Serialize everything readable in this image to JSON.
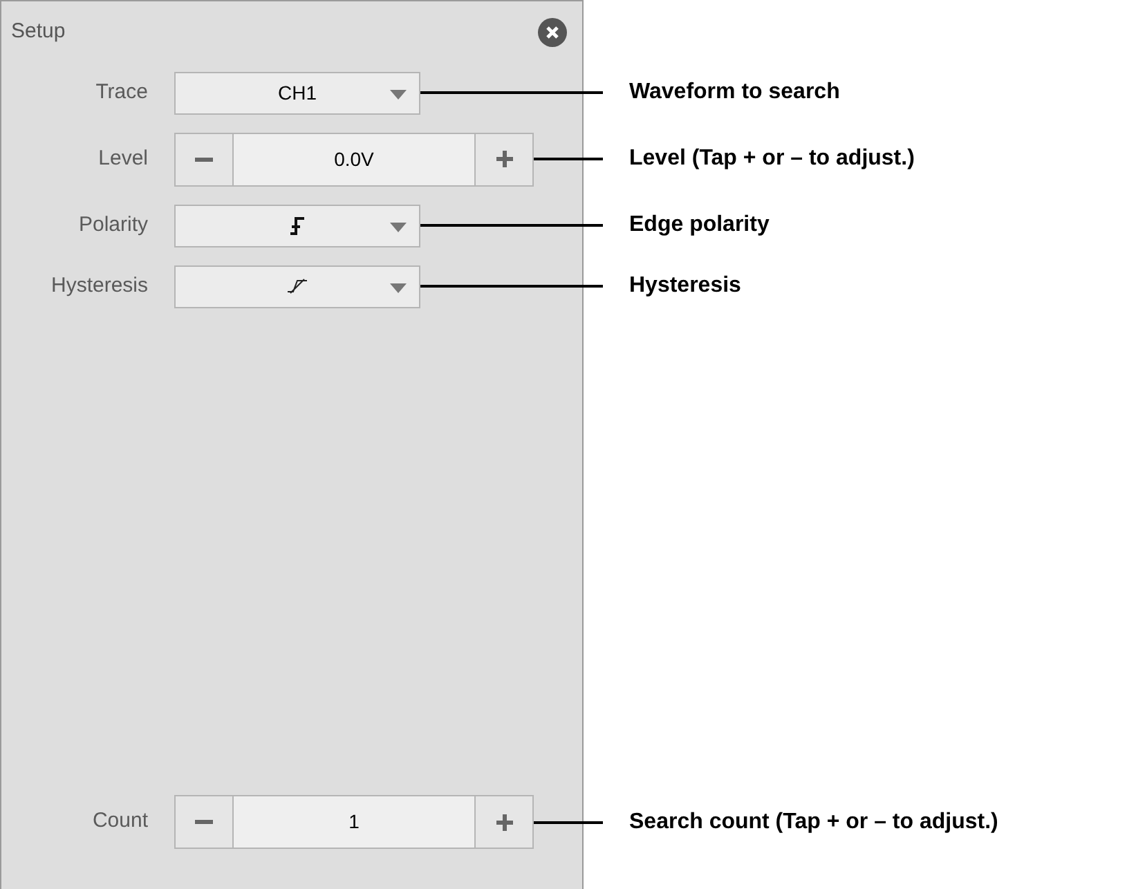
{
  "panel": {
    "title": "Setup"
  },
  "fields": [
    {
      "kind": "dropdown",
      "label": "Trace",
      "value": "CH1",
      "callout": "Waveform to search"
    },
    {
      "kind": "stepper",
      "label": "Level",
      "value": "0.0V",
      "callout": "Level (Tap + or – to adjust.)"
    },
    {
      "kind": "polarity",
      "label": "Polarity",
      "callout": "Edge polarity"
    },
    {
      "kind": "hysteresis",
      "label": "Hysteresis",
      "callout": "Hysteresis"
    }
  ],
  "bottom_fields": [
    {
      "kind": "stepper",
      "label": "Count",
      "value": "1",
      "callout": "Search count (Tap + or – to adjust.)"
    }
  ]
}
